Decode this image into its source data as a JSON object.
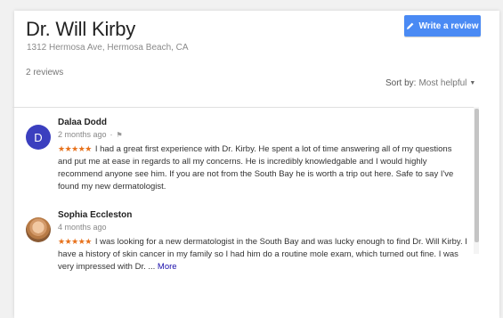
{
  "place": {
    "name": "Dr. Will Kirby",
    "address": "1312 Hermosa Ave, Hermosa Beach, CA"
  },
  "write_review_label": "Write a review",
  "review_count": "2 reviews",
  "sort": {
    "label": "Sort by:",
    "value": "Most helpful"
  },
  "colors": {
    "accent": "#4a8af4",
    "stars": "#e7711b",
    "avatar_bg": "#3b3fbf"
  },
  "reviews": [
    {
      "author": "Dalaa Dodd",
      "avatar_letter": "D",
      "time": "2 months ago",
      "stars": "★★★★★",
      "text": "I had a great first experience with Dr. Kirby. He spent a lot of time answering all of my questions and put me at ease in regards to all my concerns. He is incredibly knowledgable and I would highly recommend anyone see him. If you are not from the South Bay he is worth a trip out here. Safe to say I've found my new dermatologist.",
      "more": ""
    },
    {
      "author": "Sophia Eccleston",
      "time": "4 months ago",
      "stars": "★★★★★",
      "text": "I was looking for a new dermatologist in the South Bay and was lucky enough to find Dr. Will Kirby. I have a history of skin cancer in my family so I had him do a routine mole exam, which turned out fine. I was very impressed with Dr. ... ",
      "more": "More"
    }
  ]
}
